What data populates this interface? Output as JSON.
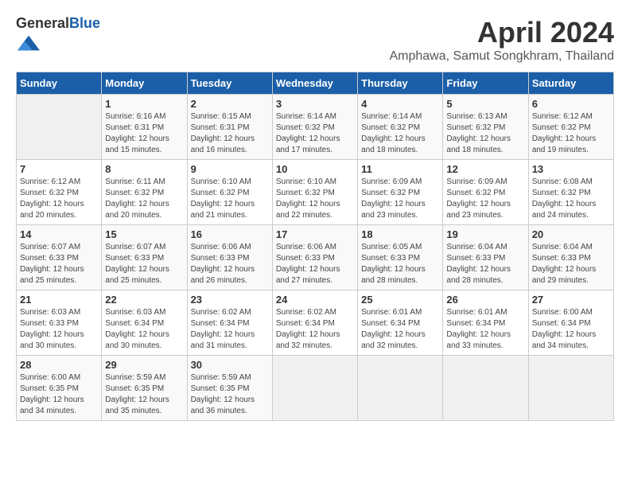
{
  "header": {
    "logo_general": "General",
    "logo_blue": "Blue",
    "month_title": "April 2024",
    "location": "Amphawa, Samut Songkhram, Thailand"
  },
  "weekdays": [
    "Sunday",
    "Monday",
    "Tuesday",
    "Wednesday",
    "Thursday",
    "Friday",
    "Saturday"
  ],
  "weeks": [
    [
      {
        "day": "",
        "sunrise": "",
        "sunset": "",
        "daylight": ""
      },
      {
        "day": "1",
        "sunrise": "Sunrise: 6:16 AM",
        "sunset": "Sunset: 6:31 PM",
        "daylight": "Daylight: 12 hours and 15 minutes."
      },
      {
        "day": "2",
        "sunrise": "Sunrise: 6:15 AM",
        "sunset": "Sunset: 6:31 PM",
        "daylight": "Daylight: 12 hours and 16 minutes."
      },
      {
        "day": "3",
        "sunrise": "Sunrise: 6:14 AM",
        "sunset": "Sunset: 6:32 PM",
        "daylight": "Daylight: 12 hours and 17 minutes."
      },
      {
        "day": "4",
        "sunrise": "Sunrise: 6:14 AM",
        "sunset": "Sunset: 6:32 PM",
        "daylight": "Daylight: 12 hours and 18 minutes."
      },
      {
        "day": "5",
        "sunrise": "Sunrise: 6:13 AM",
        "sunset": "Sunset: 6:32 PM",
        "daylight": "Daylight: 12 hours and 18 minutes."
      },
      {
        "day": "6",
        "sunrise": "Sunrise: 6:12 AM",
        "sunset": "Sunset: 6:32 PM",
        "daylight": "Daylight: 12 hours and 19 minutes."
      }
    ],
    [
      {
        "day": "7",
        "sunrise": "Sunrise: 6:12 AM",
        "sunset": "Sunset: 6:32 PM",
        "daylight": "Daylight: 12 hours and 20 minutes."
      },
      {
        "day": "8",
        "sunrise": "Sunrise: 6:11 AM",
        "sunset": "Sunset: 6:32 PM",
        "daylight": "Daylight: 12 hours and 20 minutes."
      },
      {
        "day": "9",
        "sunrise": "Sunrise: 6:10 AM",
        "sunset": "Sunset: 6:32 PM",
        "daylight": "Daylight: 12 hours and 21 minutes."
      },
      {
        "day": "10",
        "sunrise": "Sunrise: 6:10 AM",
        "sunset": "Sunset: 6:32 PM",
        "daylight": "Daylight: 12 hours and 22 minutes."
      },
      {
        "day": "11",
        "sunrise": "Sunrise: 6:09 AM",
        "sunset": "Sunset: 6:32 PM",
        "daylight": "Daylight: 12 hours and 23 minutes."
      },
      {
        "day": "12",
        "sunrise": "Sunrise: 6:09 AM",
        "sunset": "Sunset: 6:32 PM",
        "daylight": "Daylight: 12 hours and 23 minutes."
      },
      {
        "day": "13",
        "sunrise": "Sunrise: 6:08 AM",
        "sunset": "Sunset: 6:32 PM",
        "daylight": "Daylight: 12 hours and 24 minutes."
      }
    ],
    [
      {
        "day": "14",
        "sunrise": "Sunrise: 6:07 AM",
        "sunset": "Sunset: 6:33 PM",
        "daylight": "Daylight: 12 hours and 25 minutes."
      },
      {
        "day": "15",
        "sunrise": "Sunrise: 6:07 AM",
        "sunset": "Sunset: 6:33 PM",
        "daylight": "Daylight: 12 hours and 25 minutes."
      },
      {
        "day": "16",
        "sunrise": "Sunrise: 6:06 AM",
        "sunset": "Sunset: 6:33 PM",
        "daylight": "Daylight: 12 hours and 26 minutes."
      },
      {
        "day": "17",
        "sunrise": "Sunrise: 6:06 AM",
        "sunset": "Sunset: 6:33 PM",
        "daylight": "Daylight: 12 hours and 27 minutes."
      },
      {
        "day": "18",
        "sunrise": "Sunrise: 6:05 AM",
        "sunset": "Sunset: 6:33 PM",
        "daylight": "Daylight: 12 hours and 28 minutes."
      },
      {
        "day": "19",
        "sunrise": "Sunrise: 6:04 AM",
        "sunset": "Sunset: 6:33 PM",
        "daylight": "Daylight: 12 hours and 28 minutes."
      },
      {
        "day": "20",
        "sunrise": "Sunrise: 6:04 AM",
        "sunset": "Sunset: 6:33 PM",
        "daylight": "Daylight: 12 hours and 29 minutes."
      }
    ],
    [
      {
        "day": "21",
        "sunrise": "Sunrise: 6:03 AM",
        "sunset": "Sunset: 6:33 PM",
        "daylight": "Daylight: 12 hours and 30 minutes."
      },
      {
        "day": "22",
        "sunrise": "Sunrise: 6:03 AM",
        "sunset": "Sunset: 6:34 PM",
        "daylight": "Daylight: 12 hours and 30 minutes."
      },
      {
        "day": "23",
        "sunrise": "Sunrise: 6:02 AM",
        "sunset": "Sunset: 6:34 PM",
        "daylight": "Daylight: 12 hours and 31 minutes."
      },
      {
        "day": "24",
        "sunrise": "Sunrise: 6:02 AM",
        "sunset": "Sunset: 6:34 PM",
        "daylight": "Daylight: 12 hours and 32 minutes."
      },
      {
        "day": "25",
        "sunrise": "Sunrise: 6:01 AM",
        "sunset": "Sunset: 6:34 PM",
        "daylight": "Daylight: 12 hours and 32 minutes."
      },
      {
        "day": "26",
        "sunrise": "Sunrise: 6:01 AM",
        "sunset": "Sunset: 6:34 PM",
        "daylight": "Daylight: 12 hours and 33 minutes."
      },
      {
        "day": "27",
        "sunrise": "Sunrise: 6:00 AM",
        "sunset": "Sunset: 6:34 PM",
        "daylight": "Daylight: 12 hours and 34 minutes."
      }
    ],
    [
      {
        "day": "28",
        "sunrise": "Sunrise: 6:00 AM",
        "sunset": "Sunset: 6:35 PM",
        "daylight": "Daylight: 12 hours and 34 minutes."
      },
      {
        "day": "29",
        "sunrise": "Sunrise: 5:59 AM",
        "sunset": "Sunset: 6:35 PM",
        "daylight": "Daylight: 12 hours and 35 minutes."
      },
      {
        "day": "30",
        "sunrise": "Sunrise: 5:59 AM",
        "sunset": "Sunset: 6:35 PM",
        "daylight": "Daylight: 12 hours and 36 minutes."
      },
      {
        "day": "",
        "sunrise": "",
        "sunset": "",
        "daylight": ""
      },
      {
        "day": "",
        "sunrise": "",
        "sunset": "",
        "daylight": ""
      },
      {
        "day": "",
        "sunrise": "",
        "sunset": "",
        "daylight": ""
      },
      {
        "day": "",
        "sunrise": "",
        "sunset": "",
        "daylight": ""
      }
    ]
  ]
}
